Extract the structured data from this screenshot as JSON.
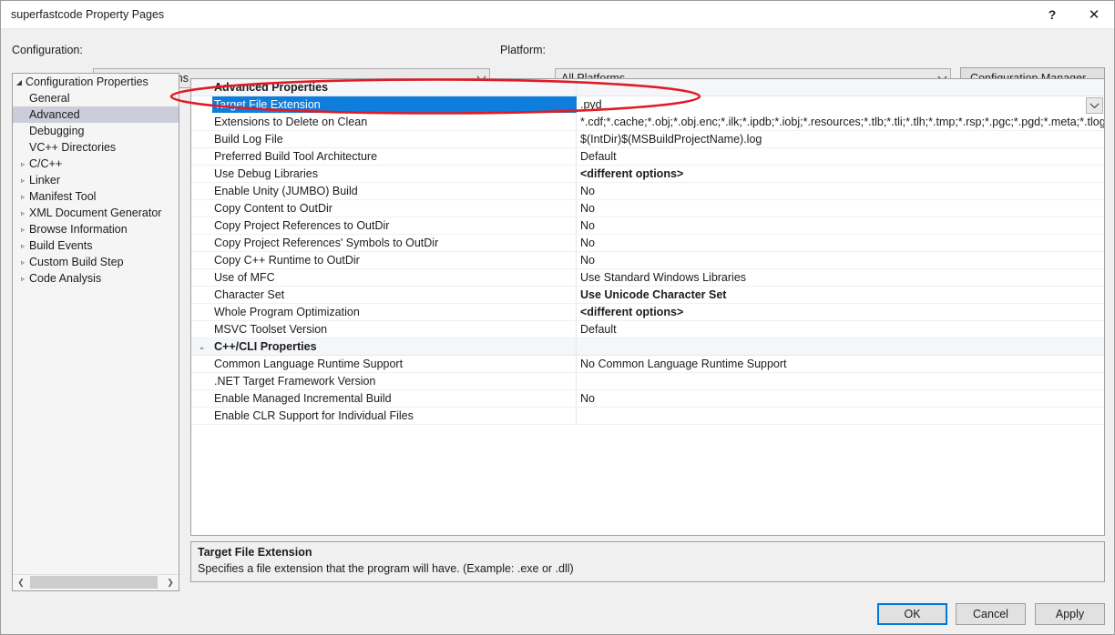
{
  "window": {
    "title": "superfastcode Property Pages",
    "help_glyph": "?",
    "close_glyph": "✕"
  },
  "toolbar": {
    "configuration_label": "Configuration:",
    "configuration_value": "All Configurations",
    "platform_label": "Platform:",
    "platform_value": "All Platforms",
    "configuration_manager_label": "Configuration Manager...",
    "dropdown_glyph": "⌄"
  },
  "sidebar": {
    "scroll_left_glyph": "❮",
    "scroll_right_glyph": "❯",
    "items": [
      {
        "label": "Configuration Properties",
        "level": 0,
        "twisty": "◢",
        "selected": false
      },
      {
        "label": "General",
        "level": 1,
        "twisty": "",
        "selected": false
      },
      {
        "label": "Advanced",
        "level": 1,
        "twisty": "",
        "selected": true
      },
      {
        "label": "Debugging",
        "level": 1,
        "twisty": "",
        "selected": false
      },
      {
        "label": "VC++ Directories",
        "level": 1,
        "twisty": "",
        "selected": false
      },
      {
        "label": "C/C++",
        "level": 1,
        "twisty": "▹",
        "selected": false
      },
      {
        "label": "Linker",
        "level": 1,
        "twisty": "▹",
        "selected": false
      },
      {
        "label": "Manifest Tool",
        "level": 1,
        "twisty": "▹",
        "selected": false
      },
      {
        "label": "XML Document Generator",
        "level": 1,
        "twisty": "▹",
        "selected": false
      },
      {
        "label": "Browse Information",
        "level": 1,
        "twisty": "▹",
        "selected": false
      },
      {
        "label": "Build Events",
        "level": 1,
        "twisty": "▹",
        "selected": false
      },
      {
        "label": "Custom Build Step",
        "level": 1,
        "twisty": "▹",
        "selected": false
      },
      {
        "label": "Code Analysis",
        "level": 1,
        "twisty": "▹",
        "selected": false
      }
    ]
  },
  "grid": {
    "expanded_glyph": "⌄",
    "dropdown_glyph": "⌄",
    "rows": [
      {
        "kind": "category",
        "name": "Advanced Properties",
        "value": ""
      },
      {
        "kind": "selected",
        "name": "Target File Extension",
        "value": ".pyd"
      },
      {
        "kind": "prop",
        "name": "Extensions to Delete on Clean",
        "value": "*.cdf;*.cache;*.obj;*.obj.enc;*.ilk;*.ipdb;*.iobj;*.resources;*.tlb;*.tli;*.tlh;*.tmp;*.rsp;*.pgc;*.pgd;*.meta;*.tlog;*.r"
      },
      {
        "kind": "prop",
        "name": "Build Log File",
        "value": "$(IntDir)$(MSBuildProjectName).log"
      },
      {
        "kind": "prop",
        "name": "Preferred Build Tool Architecture",
        "value": "Default"
      },
      {
        "kind": "prop",
        "name": "Use Debug Libraries",
        "value": "<different options>",
        "bold": true
      },
      {
        "kind": "prop",
        "name": "Enable Unity (JUMBO) Build",
        "value": "No"
      },
      {
        "kind": "prop",
        "name": "Copy Content to OutDir",
        "value": "No"
      },
      {
        "kind": "prop",
        "name": "Copy Project References to OutDir",
        "value": "No"
      },
      {
        "kind": "prop",
        "name": "Copy Project References' Symbols to OutDir",
        "value": "No"
      },
      {
        "kind": "prop",
        "name": "Copy C++ Runtime to OutDir",
        "value": "No"
      },
      {
        "kind": "prop",
        "name": "Use of MFC",
        "value": "Use Standard Windows Libraries"
      },
      {
        "kind": "prop",
        "name": "Character Set",
        "value": "Use Unicode Character Set",
        "bold": true
      },
      {
        "kind": "prop",
        "name": "Whole Program Optimization",
        "value": "<different options>",
        "bold": true
      },
      {
        "kind": "prop",
        "name": "MSVC Toolset Version",
        "value": "Default"
      },
      {
        "kind": "category",
        "name": "C++/CLI Properties",
        "value": ""
      },
      {
        "kind": "prop",
        "name": "Common Language Runtime Support",
        "value": "No Common Language Runtime Support"
      },
      {
        "kind": "prop",
        "name": ".NET Target Framework Version",
        "value": ""
      },
      {
        "kind": "prop",
        "name": "Enable Managed Incremental Build",
        "value": "No"
      },
      {
        "kind": "prop",
        "name": "Enable CLR Support for Individual Files",
        "value": ""
      }
    ]
  },
  "description": {
    "title": "Target File Extension",
    "body": "Specifies a file extension that the program will have. (Example: .exe or .dll)"
  },
  "footer": {
    "ok_label": "OK",
    "cancel_label": "Cancel",
    "apply_label": "Apply"
  },
  "colors": {
    "selection_blue": "#0f7ddb",
    "focus_blue": "#0078d7",
    "annotation_red": "#e01b24",
    "dialog_bg": "#f0f0f0"
  }
}
